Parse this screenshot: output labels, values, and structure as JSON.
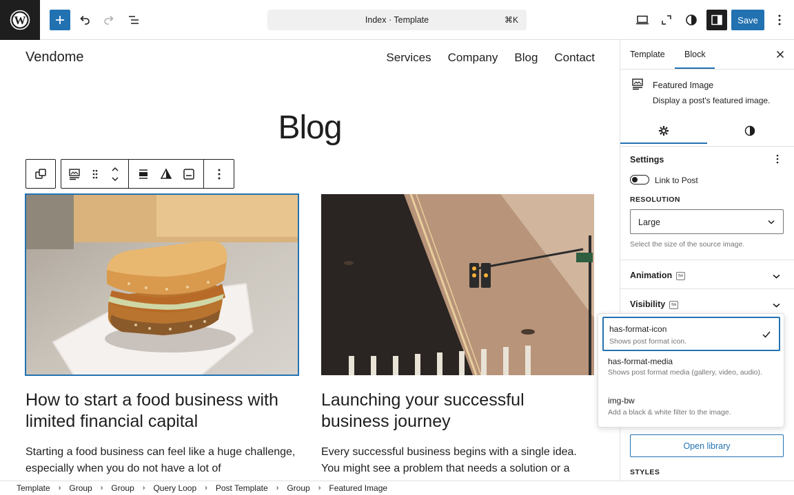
{
  "topbar": {
    "command_title": "Index · Template",
    "command_shortcut": "⌘K",
    "save_label": "Save"
  },
  "canvas": {
    "site_title": "Vendome",
    "nav": [
      "Services",
      "Company",
      "Blog",
      "Contact"
    ],
    "heading": "Blog",
    "posts": [
      {
        "title": "How to start a food business with limited financial capital",
        "excerpt": "Starting a food business can feel like a huge challenge, especially when you do not have a lot of",
        "image": "sandwich-photo"
      },
      {
        "title": "Launching your successful business journey",
        "excerpt": "Every successful business begins with a single idea. You might see a problem that needs a solution or a",
        "image": "street-traffic-light-photo"
      }
    ]
  },
  "sidebar": {
    "tabs": [
      "Template",
      "Block"
    ],
    "active_tab": "Block",
    "block": {
      "name": "Featured Image",
      "description": "Display a post's featured image."
    },
    "settings": {
      "title": "Settings",
      "link_to_post_label": "Link to Post",
      "resolution_label": "RESOLUTION",
      "resolution_value": "Large",
      "resolution_help": "Select the size of the source image."
    },
    "panels": {
      "animation": "Animation",
      "visibility": "Visibility",
      "badge": "tw"
    },
    "open_library_label": "Open library",
    "styles_label": "STYLES"
  },
  "dropdown": {
    "options": [
      {
        "title": "has-format-icon",
        "desc": "Shows post format icon.",
        "selected": true
      },
      {
        "title": "has-format-media",
        "desc": "Shows post format media (gallery, video, audio).",
        "selected": false
      },
      {
        "title": "img-bw",
        "desc": "Add a black & white filter to the image.",
        "selected": false
      }
    ]
  },
  "breadcrumb": [
    "Template",
    "Group",
    "Group",
    "Query Loop",
    "Post Template",
    "Group",
    "Featured Image"
  ],
  "colors": {
    "accent": "#2271b1",
    "dark": "#1e1e1e",
    "border": "#e0e0e0",
    "muted": "#757575"
  }
}
